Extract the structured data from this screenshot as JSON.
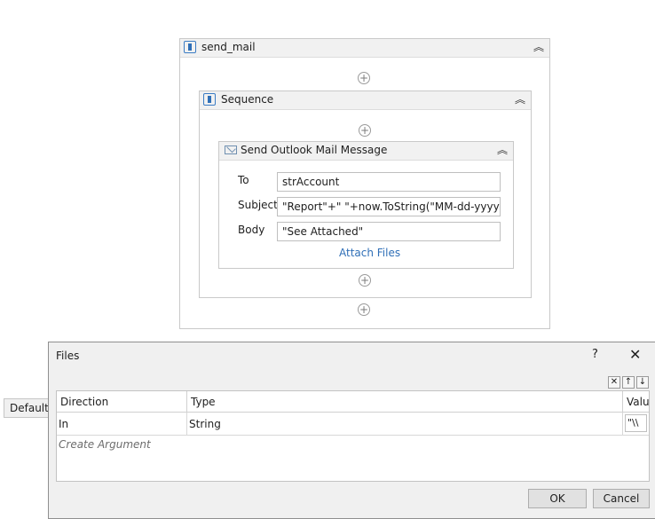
{
  "send_mail": {
    "title": "send_mail"
  },
  "sequence": {
    "title": "Sequence"
  },
  "mail_activity": {
    "title": "Send Outlook Mail Message",
    "to_label": "To",
    "to_value": "strAccount",
    "subject_label": "Subject",
    "subject_value": "\"Report\"+\" \"+now.ToString(\"MM-dd-yyyy\")",
    "body_label": "Body",
    "body_value": "\"See Attached\"",
    "attach_link": "Attach Files"
  },
  "side_panel": {
    "default_header": "Default"
  },
  "dialog": {
    "title": "Files",
    "help": "?",
    "close": "✕",
    "toolbar": {
      "delete": "✕",
      "up": "↑",
      "down": "↓"
    },
    "columns": [
      "Direction",
      "Type",
      "Valu"
    ],
    "row": {
      "direction": "In",
      "type": "String",
      "value": "\"\\\\"
    },
    "create_argument": "Create Argument",
    "ok": "OK",
    "cancel": "Cancel"
  },
  "icons": {
    "sequence": "sequence-icon",
    "mail": "mail-icon",
    "collapse": "chevron-double-up-icon",
    "add": "plus-circle-icon"
  }
}
